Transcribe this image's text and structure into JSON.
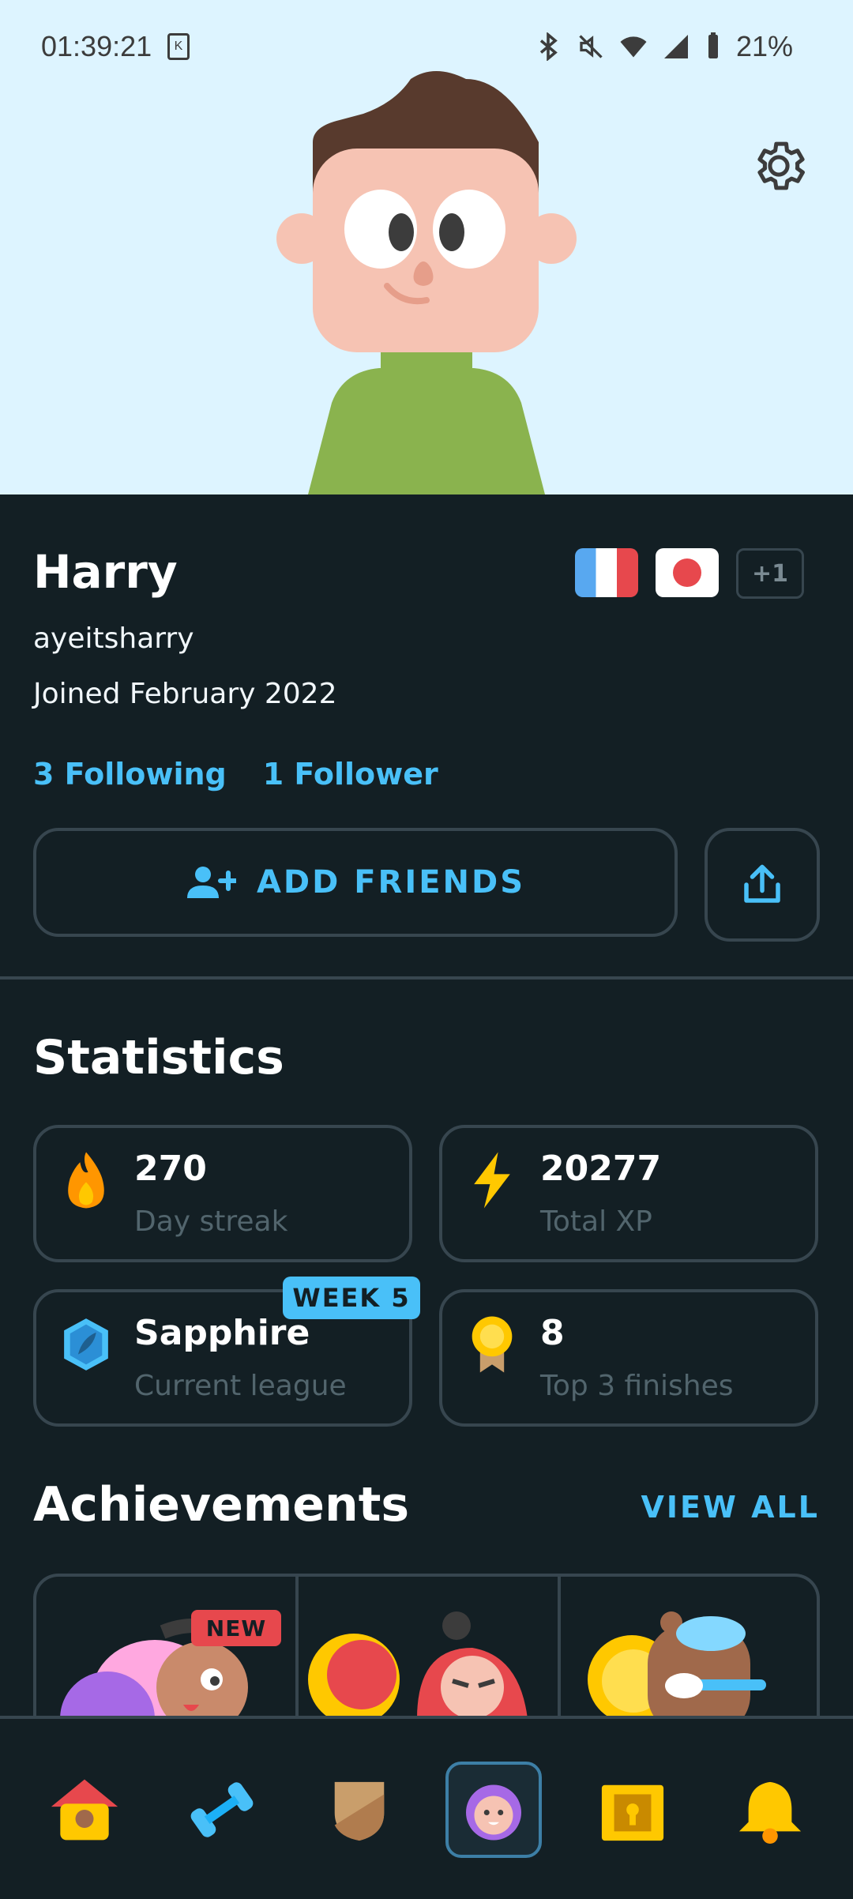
{
  "status_bar": {
    "time": "01:39:21",
    "sim_label": "K",
    "battery": "21%"
  },
  "profile": {
    "display_name": "Harry",
    "username": "ayeitsharry",
    "joined": "Joined February 2022",
    "courses_more": "+1",
    "following": "3 Following",
    "followers": "1 Follower"
  },
  "actions": {
    "add_friends_label": "ADD FRIENDS"
  },
  "statistics": {
    "title": "Statistics",
    "streak": {
      "value": "270",
      "label": "Day streak"
    },
    "xp": {
      "value": "20277",
      "label": "Total XP"
    },
    "league": {
      "value": "Sapphire",
      "label": "Current league",
      "badge": "WEEK 5"
    },
    "top3": {
      "value": "8",
      "label": "Top 3 finishes"
    }
  },
  "achievements": {
    "title": "Achievements",
    "view_all": "VIEW ALL",
    "new_badge": "NEW"
  },
  "colors": {
    "accent": "#49C0F8",
    "background": "#131F24",
    "border": "#37464F",
    "hero_bg": "#DDF4FF",
    "muted": "#52656D"
  },
  "nav": [
    "home-icon",
    "practice-icon",
    "leagues-icon",
    "profile-icon",
    "shop-icon",
    "notifications-icon"
  ]
}
